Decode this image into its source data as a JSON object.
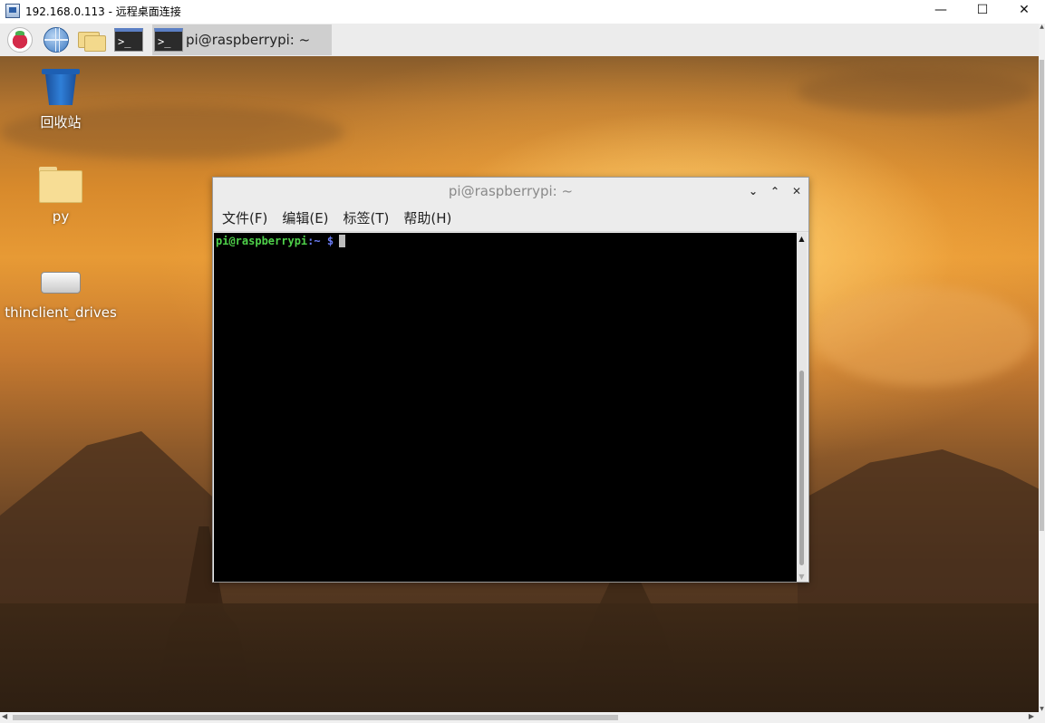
{
  "rdp_window": {
    "title": "192.168.0.113 - 远程桌面连接",
    "minimize": "—",
    "maximize": "☐",
    "close": "✕"
  },
  "panel": {
    "menu_icon": "raspberry-pi-icon",
    "browser_icon": "globe-icon",
    "file_manager_icon": "folder-icon",
    "terminal_icon": "terminal-icon",
    "terminal_glyph": ">_",
    "task_label": "pi@raspberrypi: ~"
  },
  "desktop": {
    "icons": [
      {
        "label": "回收站",
        "icon": "trash-icon"
      },
      {
        "label": "py",
        "icon": "folder-icon"
      },
      {
        "label": "thinclient_drives",
        "icon": "drive-icon"
      }
    ]
  },
  "terminal": {
    "title": "pi@raspberrypi: ~",
    "controls": {
      "minimize": "⌄",
      "maximize": "⌃",
      "close": "✕"
    },
    "menu": [
      "文件(F)",
      "编辑(E)",
      "标签(T)",
      "帮助(H)"
    ],
    "prompt_user": "pi@raspberrypi",
    "prompt_path": ":~",
    "prompt_symbol": "$",
    "colors": {
      "user": "#4fd14a",
      "path": "#6b7cf5",
      "background": "#000000"
    }
  }
}
